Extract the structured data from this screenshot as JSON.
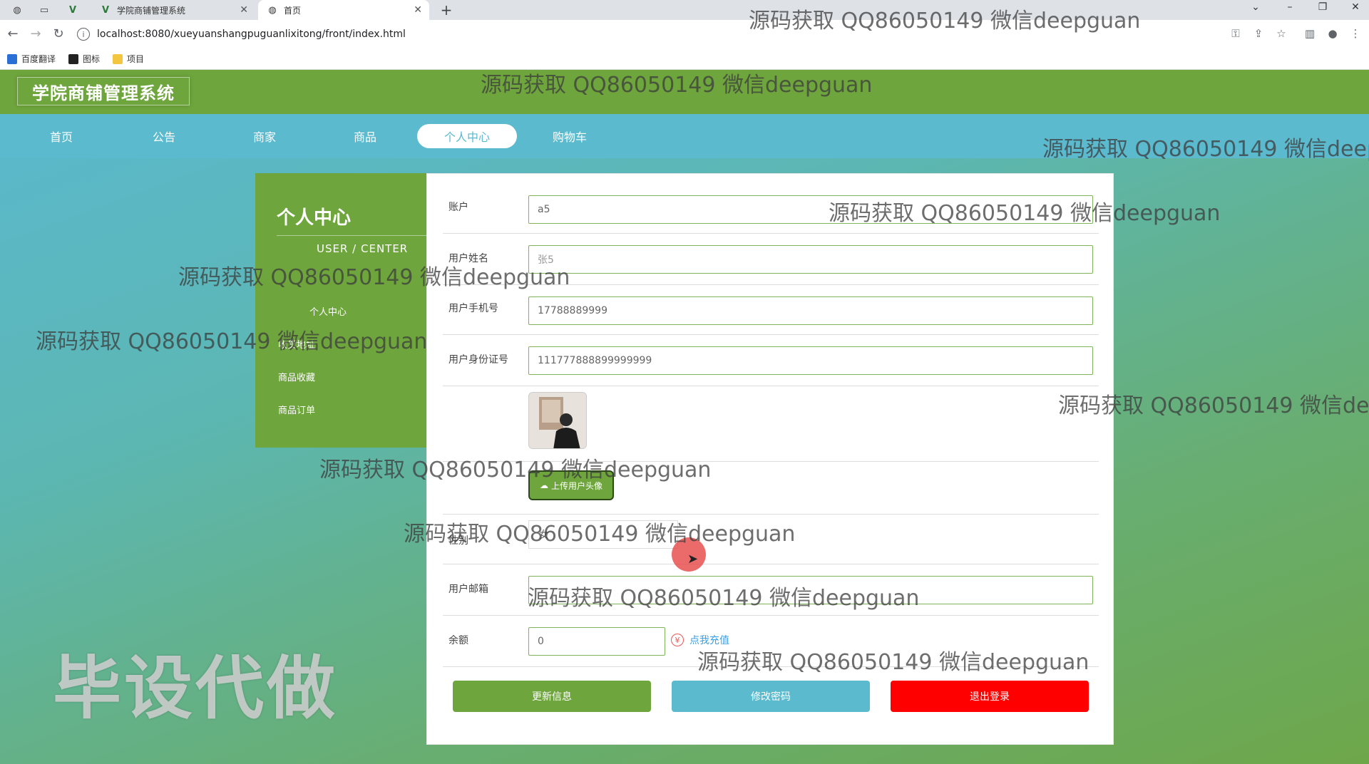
{
  "browser": {
    "tabs": [
      {
        "title": "学院商铺管理系统",
        "active": false
      },
      {
        "title": "首页",
        "active": true
      }
    ],
    "url": "localhost:8080/xueyuanshangpuguanlixitong/front/index.html",
    "bookmarks": [
      "百度翻译",
      "图标",
      "项目"
    ]
  },
  "site": {
    "title": "学院商铺管理系统",
    "nav": [
      "首页",
      "公告",
      "商家",
      "商品",
      "个人中心",
      "购物车"
    ],
    "active_nav": "个人中心"
  },
  "sidebar": {
    "title": "个人中心",
    "subtitle": "USER / CENTER",
    "items": [
      "个人中心",
      "收货地址",
      "商品收藏",
      "商品订单"
    ]
  },
  "form": {
    "account_label": "账户",
    "account_value": "a5",
    "name_label": "用户姓名",
    "name_value": "张5",
    "phone_label": "用户手机号",
    "phone_value": "17788889999",
    "idcard_label": "用户身份证号",
    "idcard_value": "111777888899999999",
    "upload_label": "上传用户头像",
    "gender_label": "性别",
    "gender_value": "女",
    "email_label": "用户邮箱",
    "email_value": "",
    "balance_label": "余额",
    "balance_value": "0",
    "recharge_label": "点我充值"
  },
  "actions": {
    "update": "更新信息",
    "password": "修改密码",
    "logout": "退出登录"
  },
  "overlay": {
    "watermark": "源码获取 QQ86050149 微信deepguan",
    "banner": "毕设代做"
  },
  "colors": {
    "header_green": "#6ea53c",
    "nav_blue": "#5bbacd",
    "logout_red": "#ff0000"
  }
}
